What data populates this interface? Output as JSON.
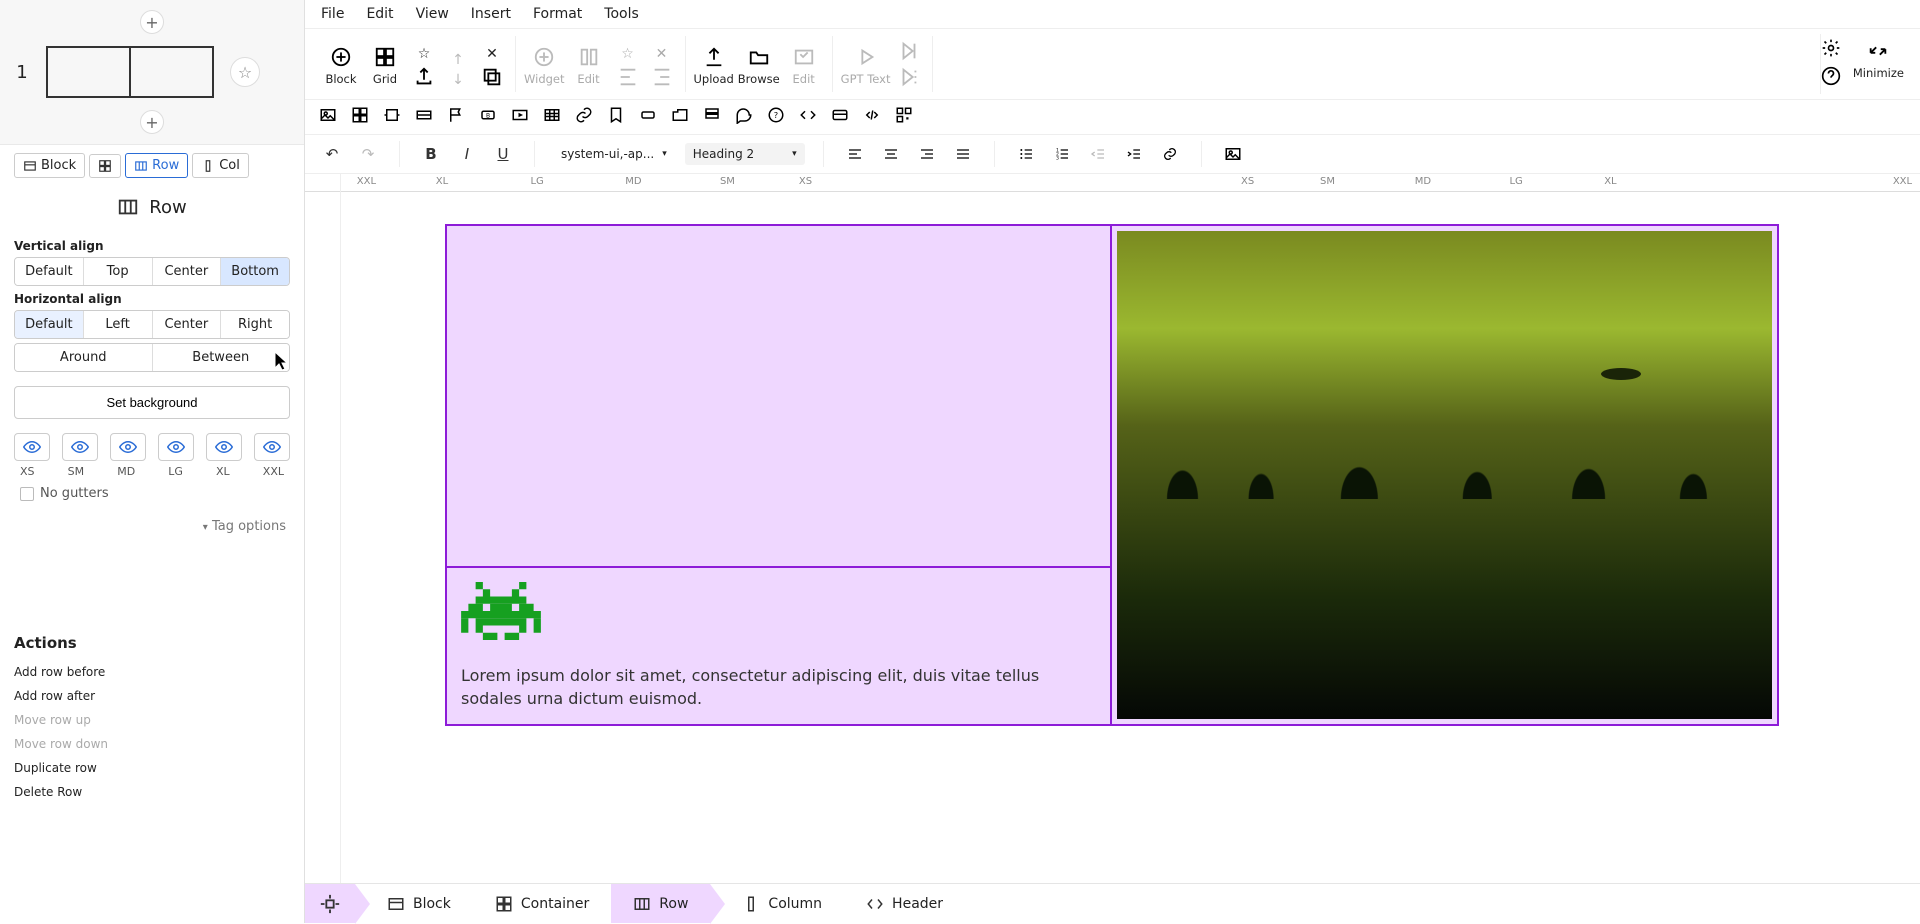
{
  "menu": [
    "File",
    "Edit",
    "View",
    "Insert",
    "Format",
    "Tools"
  ],
  "toolbar": {
    "block": "Block",
    "grid": "Grid",
    "widget": "Widget",
    "edit": "Edit",
    "upload": "Upload",
    "browse": "Browse",
    "edit2": "Edit",
    "gpt": "GPT Text",
    "minimize": "Minimize"
  },
  "format": {
    "font": "system-ui,-ap...",
    "heading": "Heading 2"
  },
  "ruler": [
    "XXL",
    "XL",
    "LG",
    "MD",
    "SM",
    "XS",
    "XS",
    "SM",
    "MD",
    "LG",
    "XL",
    "XXL"
  ],
  "sidebar": {
    "block_index": "1",
    "tabs": {
      "block": "Block",
      "row": "Row",
      "col": "Col"
    },
    "title": "Row",
    "valign_label": "Vertical align",
    "valign": [
      "Default",
      "Top",
      "Center",
      "Bottom"
    ],
    "halign_label": "Horizontal align",
    "halign1": [
      "Default",
      "Left",
      "Center",
      "Right"
    ],
    "halign2": [
      "Around",
      "Between"
    ],
    "set_bg": "Set background",
    "breakpoints": [
      "XS",
      "SM",
      "MD",
      "LG",
      "XL",
      "XXL"
    ],
    "no_gutters": "No gutters",
    "tag_options": "Tag options",
    "actions_title": "Actions",
    "actions": [
      "Add row before",
      "Add row after",
      "Move row up",
      "Move row down",
      "Duplicate row",
      "Delete Row"
    ]
  },
  "canvas": {
    "lorem": "Lorem ipsum dolor sit amet, consectetur adipiscing elit, duis vitae tellus sodales urna dictum euismod."
  },
  "breadcrumb": [
    "Block",
    "Container",
    "Row",
    "Column",
    "Header"
  ]
}
